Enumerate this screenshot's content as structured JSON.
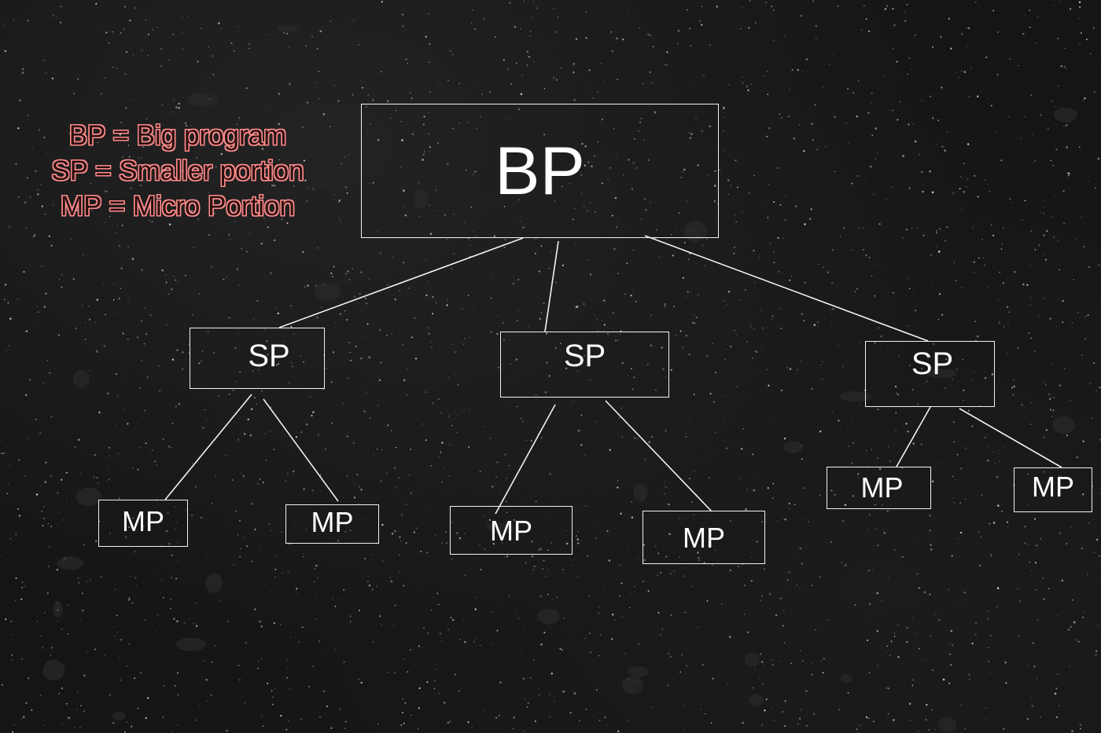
{
  "legend": {
    "bp": "BP = Big program",
    "sp": "SP = Smaller portion",
    "mp": "MP = Micro Portion"
  },
  "root": {
    "label": "BP",
    "children": [
      {
        "label": "SP",
        "children": [
          {
            "label": "MP"
          },
          {
            "label": "MP"
          }
        ]
      },
      {
        "label": "SP",
        "children": [
          {
            "label": "MP"
          },
          {
            "label": "MP"
          }
        ]
      },
      {
        "label": "SP",
        "children": [
          {
            "label": "MP"
          },
          {
            "label": "MP"
          }
        ]
      }
    ]
  },
  "colors": {
    "background": "#151515",
    "box_border": "#f2f2f2",
    "box_text": "#ffffff",
    "legend_text_outline": "#ff8c8c"
  }
}
